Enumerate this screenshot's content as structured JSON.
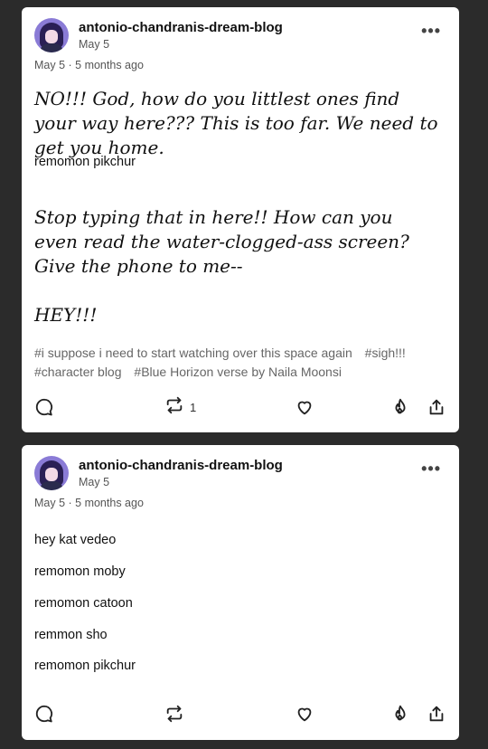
{
  "posts": [
    {
      "blog_name": "antonio-chandranis-dream-blog",
      "date": "May 5",
      "timeline": "May 5 · 5 months ago",
      "paragraphs": [
        "NO!!! God, how do you littlest ones find your way here??? This is too far. We need to get you home.",
        "remomon pikchur",
        "Stop typing that in here!! How can you even read the water-clogged-ass screen? Give the phone to me--",
        "HEY!!!"
      ],
      "tags": [
        "#i suppose i need to start watching over this space again",
        "#sigh!!!",
        "#character blog",
        "#Blue Horizon verse by Naila Moonsi"
      ],
      "reblog_count": "1"
    },
    {
      "blog_name": "antonio-chandranis-dream-blog",
      "date": "May 5",
      "timeline": "May 5 · 5 months ago",
      "paragraphs": [
        "hey kat vedeo",
        "remomon moby",
        "remomon catoon",
        "remmon sho",
        "remomon pikchur"
      ]
    }
  ],
  "icons": {
    "avatar": "avatar-image",
    "more": "more-options-icon",
    "reply": "reply-bubble-icon",
    "reblog": "reblog-icon",
    "like": "heart-icon",
    "blaze": "flame-icon",
    "share": "share-icon"
  }
}
